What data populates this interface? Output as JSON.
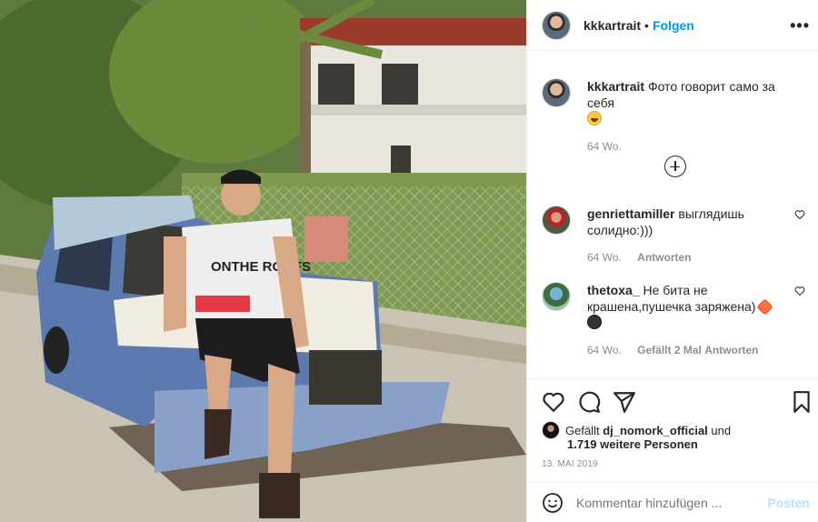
{
  "photo": {
    "shirt_text": "ONTHE ROOFS"
  },
  "header": {
    "username": "kkkartrait",
    "separator": "•",
    "follow_label": "Folgen",
    "more_label": "•••"
  },
  "caption": {
    "username": "kkkartrait",
    "text": "Фото говорит само за себя",
    "time": "64 Wo."
  },
  "comments": [
    {
      "username": "genriettamiller",
      "text": "выглядишь солидно:)))",
      "time": "64 Wo.",
      "reply_label": "Antworten"
    },
    {
      "username": "thetoxa_",
      "text": "Не бита не крашена,пушечка заряжена)",
      "time": "64 Wo.",
      "likes": "Gefällt 2 Mal",
      "reply_label": "Antworten"
    }
  ],
  "likes": {
    "prefix": "Gefällt",
    "user": "dj_nomork_official",
    "connector": "und",
    "others": "1.719 weitere Personen"
  },
  "date": "13. MAI 2019",
  "add_comment": {
    "placeholder": "Kommentar hinzufügen ...",
    "post_label": "Posten"
  },
  "icons": [
    "heart-icon",
    "comment-icon",
    "share-icon",
    "bookmark-icon",
    "add-comments-icon",
    "emoji-icon",
    "more-icon"
  ]
}
